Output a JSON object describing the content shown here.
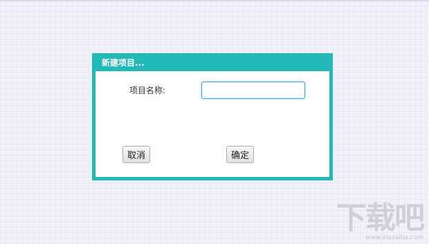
{
  "dialog": {
    "title": "新建项目...",
    "name_label": "项目名称:",
    "name_value": "",
    "cancel_label": "取消",
    "ok_label": "确定"
  },
  "watermark": {
    "text": "下载吧",
    "sub": "www.xiazaiba.com"
  },
  "colors": {
    "dialog_border": "#21b9b8",
    "page_background": "#f1f1fb",
    "input_focus": "#3aa6d8"
  }
}
